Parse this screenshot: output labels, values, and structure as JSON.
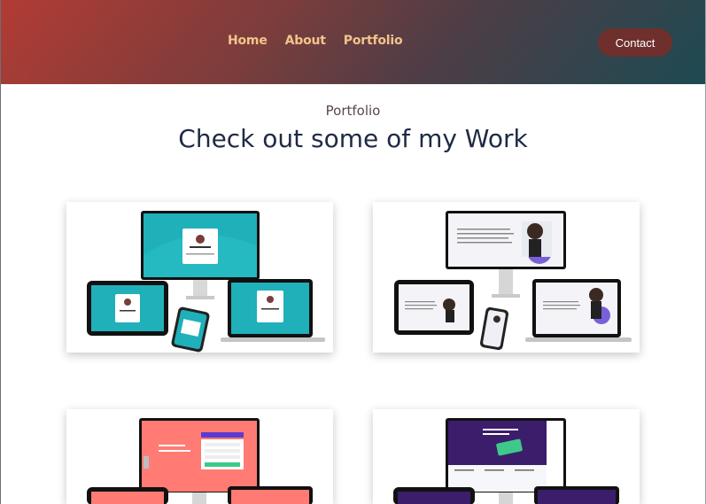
{
  "nav": {
    "items": [
      "Home",
      "About",
      "Portfolio"
    ],
    "contact_label": "Contact"
  },
  "portfolio": {
    "label": "Portfolio",
    "title": "Check out some of my Work",
    "projects": [
      {
        "name": "profile-card-project",
        "screen_color": "#1fb0ba"
      },
      {
        "name": "testimonial-project",
        "screen_color": "#f4f4f8"
      },
      {
        "name": "signup-form-project",
        "screen_color": "#ff7b73"
      },
      {
        "name": "landing-page-project",
        "screen_color": "#3b1d6b"
      }
    ]
  },
  "colors": {
    "nav_link": "#f2c48b",
    "contact_bg": "#6e2f2d",
    "title": "#1f2a44",
    "label": "#5a4550"
  }
}
